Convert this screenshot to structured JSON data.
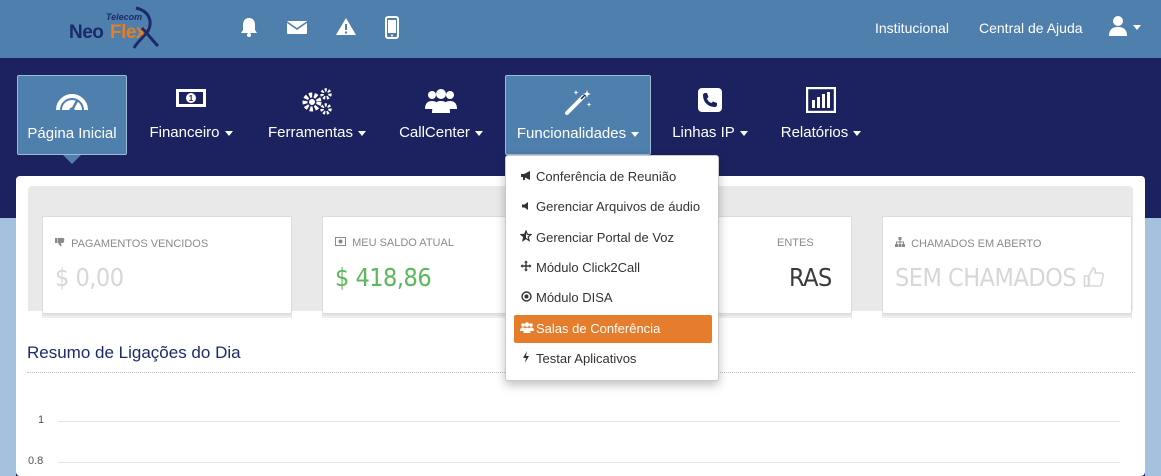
{
  "brand": {
    "telecom": "Telecom",
    "neo": "Neo",
    "flex": "Flex",
    "accent": "#e67e22",
    "primary": "#1b2a6b"
  },
  "topbar": {
    "icons": [
      "bell-icon",
      "envelope-icon",
      "warning-icon",
      "mobile-icon"
    ],
    "links": [
      "Institucional",
      "Central de Ajuda"
    ],
    "user_icon": "user-icon"
  },
  "nav": {
    "items": [
      {
        "label": "Página Inicial",
        "icon": "dashboard-icon",
        "active": true
      },
      {
        "label": "Financeiro",
        "icon": "money-icon",
        "dropdown": true
      },
      {
        "label": "Ferramentas",
        "icon": "gears-icon",
        "dropdown": true
      },
      {
        "label": "CallCenter",
        "icon": "users-icon",
        "dropdown": true
      },
      {
        "label": "Funcionalidades",
        "icon": "magic-icon",
        "dropdown": true,
        "open": true
      },
      {
        "label": "Linhas IP",
        "icon": "phone-icon",
        "dropdown": true
      },
      {
        "label": "Relatórios",
        "icon": "bar-chart-icon",
        "dropdown": true
      }
    ]
  },
  "funcionalidades_menu": [
    {
      "label": "Conferência de Reunião",
      "icon": "bullhorn-icon"
    },
    {
      "label": "Gerenciar Arquivos de áudio",
      "icon": "volume-icon"
    },
    {
      "label": "Gerenciar Portal de Voz",
      "icon": "star-half-icon"
    },
    {
      "label": "Módulo Click2Call",
      "icon": "arrows-icon"
    },
    {
      "label": "Módulo DISA",
      "icon": "dot-circle-icon"
    },
    {
      "label": "Salas de Conferência",
      "icon": "users-icon",
      "highlighted": true
    },
    {
      "label": "Testar Aplicativos",
      "icon": "bolt-icon"
    }
  ],
  "cards": [
    {
      "title": "Pagamentos vencidos",
      "icon": "thumbs-down-icon",
      "value": "$ 0,00"
    },
    {
      "title": "Meu saldo atual",
      "icon": "money-icon",
      "value": "$ 418,86"
    },
    {
      "title_suffix": "ENTES",
      "value_suffix": "RAS"
    },
    {
      "title": "Chamados em aberto",
      "icon": "sitemap-icon",
      "value": "SEM CHAMADOS"
    }
  ],
  "section": {
    "title": "Resumo de Ligações do Dia"
  },
  "chart": {
    "ticks": [
      "1",
      "0.8"
    ]
  },
  "colors": {
    "topbar": "#4f7fac",
    "navbar": "#1c2260",
    "positive": "#5cb85c",
    "highlight": "#e57d2c"
  }
}
